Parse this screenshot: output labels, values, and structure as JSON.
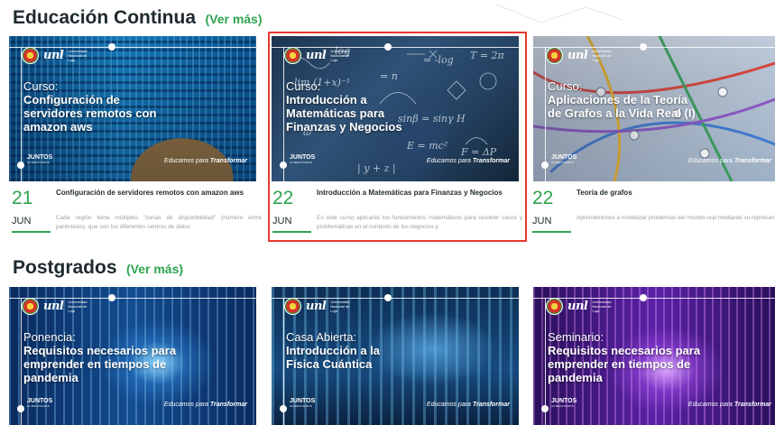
{
  "sections": {
    "continuing": {
      "title": "Educación Continua",
      "more": "(Ver más)"
    },
    "postgrad": {
      "title": "Postgrados",
      "more": "(Ver más)"
    }
  },
  "brand": {
    "logo_mark": "unl",
    "logo_sub": "Universidad Nacional de Loja",
    "juntos": "JUNTOS",
    "acreditamos": "ACREDITAMOS",
    "tagline_italic": "Educamos para",
    "tagline_bold": "Transformar"
  },
  "courses": [
    {
      "kind": "Curso:",
      "name": "Configuración de servidores remotos con amazon aws",
      "day": "21",
      "month": "JUN",
      "title": "Configuración de servidores remotos con amazon aws",
      "description": "Cada región tiene múltiples \"zonas de disponibilidad\" (número entre paréntesis), que son los diferentes centros de datos"
    },
    {
      "kind": "Curso:",
      "name": "Introducción a Matemáticas para Finanzas y Negocios",
      "day": "22",
      "month": "JUN",
      "title": "Introducción a Matemáticas para Finanzas y Negocios",
      "description": "En este curso aplicarás los fundamentos matemáticos para resolver casos y problemáticas en el contexto de los negocios y"
    },
    {
      "kind": "Curso:",
      "name": "Aplicaciones de la Teoría de Grafos a la Vida Real (I)",
      "day": "22",
      "month": "JUN",
      "title": "Teoría de grafos",
      "description": "Aprenderemos a modelizar problemas del mundo real mediante su representación con grafos y a resolverlos mediante sus alg"
    }
  ],
  "postgrads": [
    {
      "kind": "Ponencia:",
      "name": "Requisitos necesarios para emprender en tiempos de pandemia"
    },
    {
      "kind": "Casa Abierta:",
      "name": "Introducción a la Física Cuántica"
    },
    {
      "kind": "Seminario:",
      "name": "Requisitos necesarios para emprender en tiempos de pandemia"
    }
  ],
  "colors": {
    "accent_green": "#2ea44f",
    "highlight_red": "#e8392f"
  },
  "icons": {
    "seal": "university-seal-icon"
  }
}
